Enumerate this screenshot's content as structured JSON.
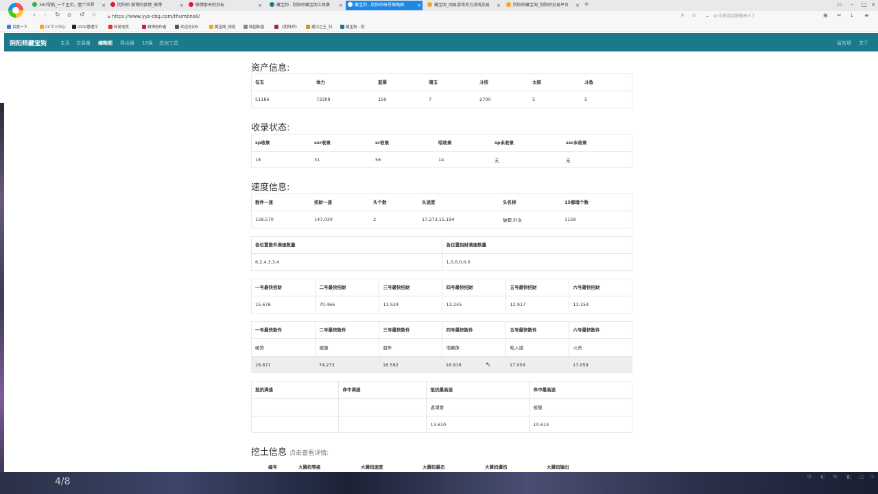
{
  "browser": {
    "tabs": [
      {
        "label": "360导航_一个主页，整个世界",
        "active": false
      },
      {
        "label": "阴阳师-微博的微博_微博",
        "active": false
      },
      {
        "label": "微博那天阿页标",
        "active": false
      },
      {
        "label": "藏宝狗 - 阴阳师藏宝阁工具集",
        "active": false
      },
      {
        "label": "藏宝狗 - 阴阳师账号缩略图",
        "active": true
      },
      {
        "label": "藏宝阁_网易游戏官方游戏交易",
        "active": false
      },
      {
        "label": "阴阳师藏宝阁_阴阳师交易平台",
        "active": false
      }
    ],
    "url_scheme": "https://",
    "url_rest": "www.yys-cbg.com/thumbnail/",
    "search_placeholder": "中美对话前瞻来火了",
    "bookmarks": [
      "百度一下",
      "CC个人中心",
      "IOOL管理平",
      "网易电竞",
      "微博创作者",
      "欢迎访问N",
      "藏宝阁_网易",
      "韩国韩国",
      "《阴阳师》",
      "建功之王_扫",
      "藏宝狗 - 阴"
    ]
  },
  "site": {
    "brand": "阴阳师藏宝狗",
    "nav": [
      "主页",
      "交易量",
      "缩略图",
      "导出器",
      "18换",
      "其他工具"
    ],
    "active_nav": "缩略图",
    "nav_right": [
      "留言墙",
      "关于"
    ]
  },
  "assets": {
    "title": "资产信息:",
    "headers": [
      "勾玉",
      "体力",
      "蓝票",
      "魂玉",
      "斗技",
      "太鼓",
      "斗鱼"
    ],
    "values": [
      "51186",
      "73309",
      "159",
      "7",
      "2700",
      "5",
      "5"
    ]
  },
  "collection": {
    "title": "收录状态:",
    "headers": [
      "sp收录",
      "ssr收录",
      "sr收录",
      "呱收录",
      "sp未收录",
      "ssr未收录"
    ],
    "values": [
      "18",
      "31",
      "56",
      "14",
      "无",
      "无"
    ]
  },
  "speed": {
    "title": "速度信息:",
    "table1": {
      "headers": [
        "散件一速",
        "招财一速",
        "头个数",
        "头速度",
        "头名称",
        "15御魂个数"
      ],
      "values": [
        "158.570",
        "147.030",
        "2",
        "17.273,15.194",
        "破服,针女",
        "1158"
      ]
    },
    "table2": {
      "headers": [
        "各位置散件满速数量",
        "各位置招财满速数量"
      ],
      "values": [
        "6,2,4,3,3,4",
        "1,0,0,0,0,0"
      ]
    },
    "table3": {
      "headers": [
        "一号最快招财",
        "二号最快招财",
        "三号最快招财",
        "四号最快招财",
        "五号最快招财",
        "六号最快招财"
      ],
      "values": [
        "15.676",
        "70.466",
        "13.524",
        "13.245",
        "12.917",
        "13.154"
      ]
    },
    "table4": {
      "headers": [
        "一号最快散件",
        "二号最快散件",
        "三号最快散件",
        "四号最快散件",
        "五号最快散件",
        "六号最快散件"
      ],
      "names": [
        "破势",
        "被服",
        "胧车",
        "地藏像",
        "轮入道",
        "火灵"
      ],
      "values": [
        "16.671",
        "74.273",
        "16.592",
        "16.916",
        "17.059",
        "17.059"
      ]
    },
    "table5": {
      "headers": [
        "抵抗满速",
        "命中满速",
        "抵抗最高速",
        "命中最高速"
      ],
      "row1": [
        "",
        "",
        "返魂香",
        "被服"
      ],
      "row2": [
        "",
        "",
        "13.610",
        "10.614"
      ]
    }
  },
  "digging": {
    "title": "挖土信息",
    "subtitle": "点击查看详情:",
    "headers": [
      "编号",
      "大舅妈等级",
      "大舅妈速度",
      "大舅妈暴击",
      "大舅妈爆伤",
      "大舅妈输出"
    ]
  },
  "taskbar": {
    "counter": "4/8"
  }
}
